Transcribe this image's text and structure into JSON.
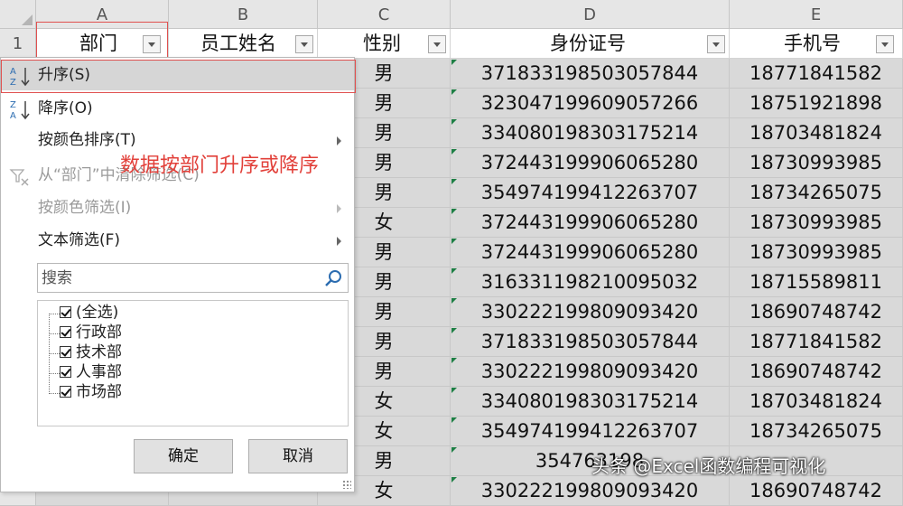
{
  "columns": [
    "A",
    "B",
    "C",
    "D",
    "E"
  ],
  "row_number": "1",
  "headers": [
    "部门",
    "员工姓名",
    "性别",
    "身份证号",
    "手机号"
  ],
  "rows": [
    {
      "gender": "男",
      "id": "371833198503057844",
      "phone": "18771841582"
    },
    {
      "gender": "男",
      "id": "323047199609057266",
      "phone": "18751921898"
    },
    {
      "gender": "男",
      "id": "334080198303175214",
      "phone": "18703481824"
    },
    {
      "gender": "男",
      "id": "372443199906065280",
      "phone": "18730993985"
    },
    {
      "gender": "男",
      "id": "354974199412263707",
      "phone": "18734265075"
    },
    {
      "gender": "女",
      "id": "372443199906065280",
      "phone": "18730993985"
    },
    {
      "gender": "男",
      "id": "372443199906065280",
      "phone": "18730993985"
    },
    {
      "gender": "男",
      "id": "316331198210095032",
      "phone": "18715589811"
    },
    {
      "gender": "男",
      "id": "330222199809093420",
      "phone": "18690748742"
    },
    {
      "gender": "男",
      "id": "371833198503057844",
      "phone": "18771841582"
    },
    {
      "gender": "男",
      "id": "330222199809093420",
      "phone": "18690748742"
    },
    {
      "gender": "女",
      "id": "334080198303175214",
      "phone": "18703481824"
    },
    {
      "gender": "女",
      "id": "354974199412263707",
      "phone": "18734265075"
    },
    {
      "gender": "男",
      "id": "354763198",
      "phone": ""
    },
    {
      "gender": "女",
      "id": "330222199809093420",
      "phone": "18690748742"
    }
  ],
  "menu": {
    "sort_asc": "升序(S)",
    "sort_desc": "降序(O)",
    "sort_by_color": "按颜色排序(T)",
    "clear_filter": "从“部门”中清除筛选(C)",
    "filter_by_color": "按颜色筛选(I)",
    "text_filter": "文本筛选(F)",
    "search_placeholder": "搜索",
    "items": [
      {
        "label": "(全选)",
        "checked": true
      },
      {
        "label": "行政部",
        "checked": true
      },
      {
        "label": "技术部",
        "checked": true
      },
      {
        "label": "人事部",
        "checked": true
      },
      {
        "label": "市场部",
        "checked": true
      }
    ],
    "ok": "确定",
    "cancel": "取消"
  },
  "annotation": "数据按部门升序或降序",
  "watermark": "头条 @Excel函数编程可视化",
  "colors": {
    "highlight": "#e0504f",
    "green_marker": "#1e7f45",
    "selection": "#d6d6d6"
  }
}
